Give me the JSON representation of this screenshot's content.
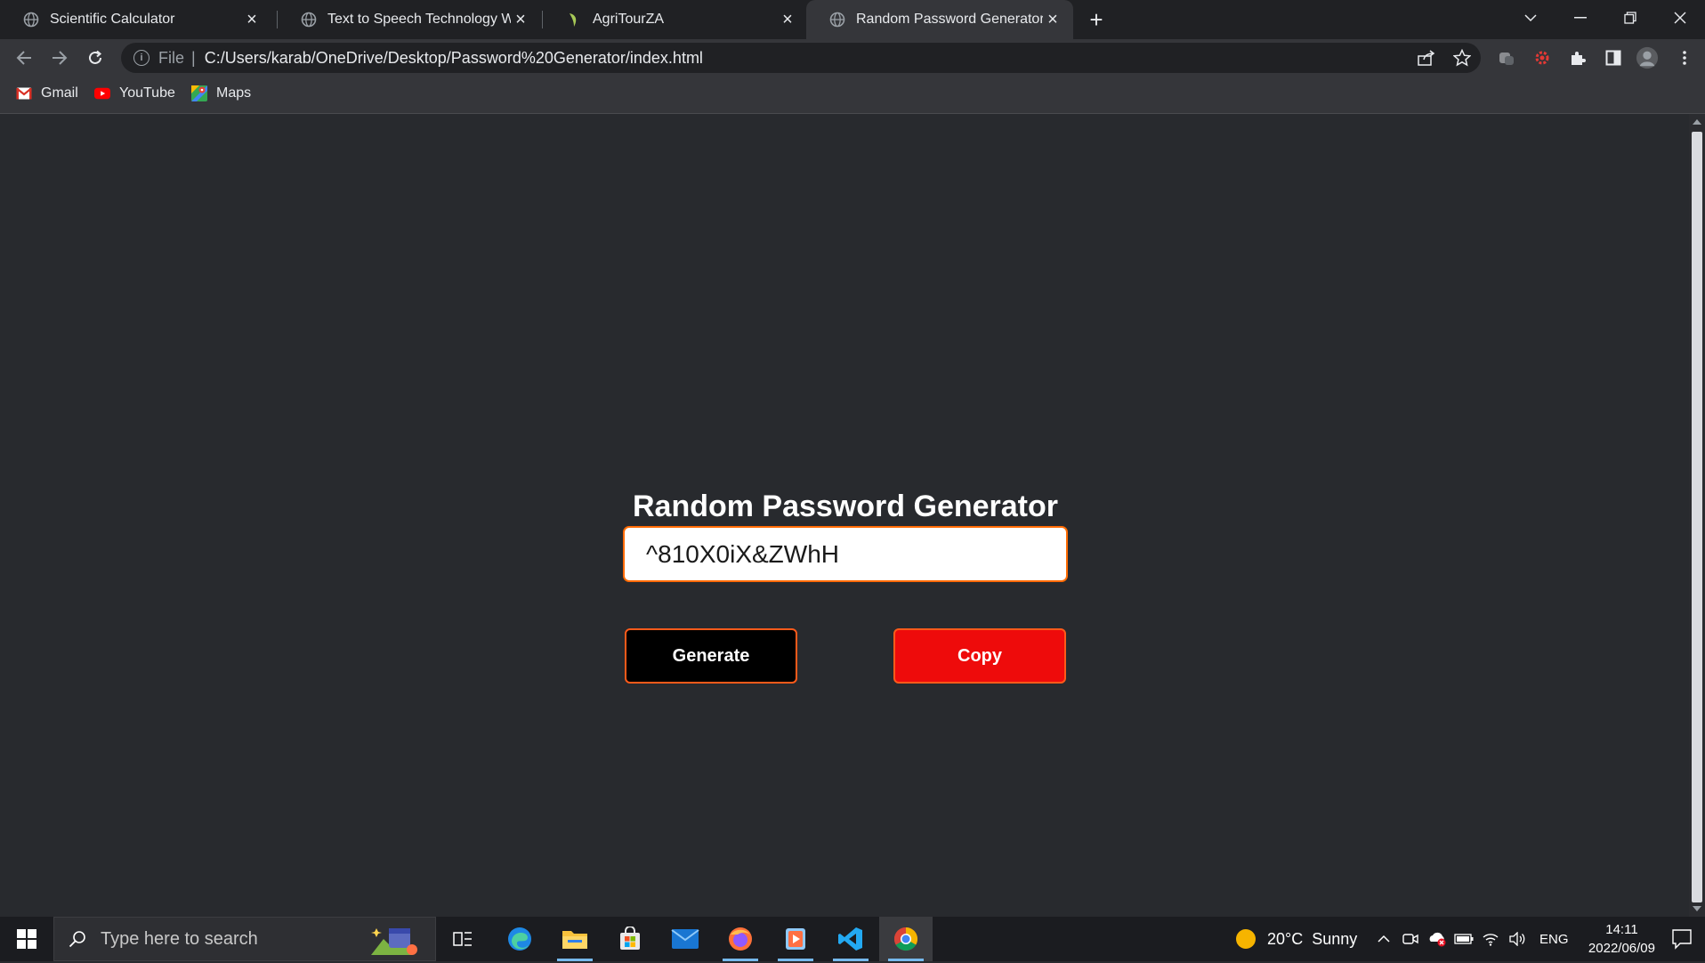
{
  "browser": {
    "tabs": [
      {
        "title": "Scientific Calculator",
        "icon": "globe-icon",
        "active": false
      },
      {
        "title": "Text to Speech Technology Web A",
        "icon": "globe-icon",
        "active": false
      },
      {
        "title": "AgriTourZA",
        "icon": "leaf-icon",
        "active": false
      },
      {
        "title": "Random Password Generator",
        "icon": "globe-icon",
        "active": true
      }
    ],
    "address": {
      "scheme": "File",
      "url": "C:/Users/karab/OneDrive/Desktop/Password%20Generator/index.html"
    },
    "bookmarks": [
      {
        "label": "Gmail",
        "icon": "gmail-icon"
      },
      {
        "label": "YouTube",
        "icon": "youtube-icon"
      },
      {
        "label": "Maps",
        "icon": "maps-icon"
      }
    ]
  },
  "page": {
    "title": "Random Password Generator",
    "password_value": "^810X0iX&ZWhH",
    "generate_label": "Generate",
    "copy_label": "Copy",
    "colors": {
      "accent_border": "#ff5a1a",
      "copy_bg": "#ee0b0b",
      "generate_bg": "#000000",
      "page_bg": "#282a2e"
    }
  },
  "taskbar": {
    "search_placeholder": "Type here to search",
    "weather": {
      "temp": "20°C",
      "condition": "Sunny"
    },
    "language": "ENG",
    "time": "14:11",
    "date": "2022/06/09"
  }
}
